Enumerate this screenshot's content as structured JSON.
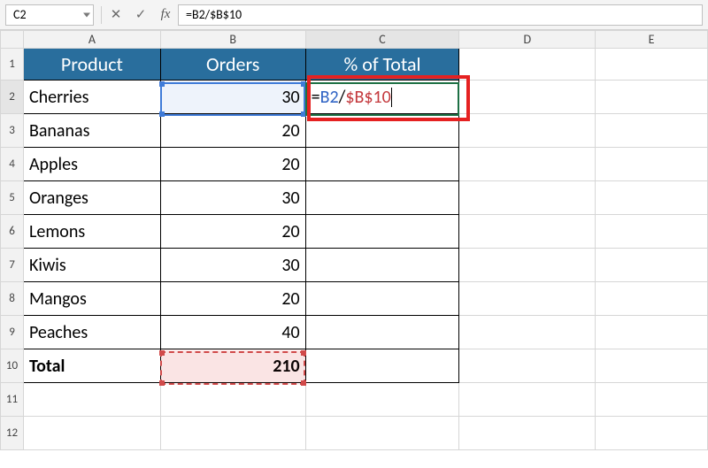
{
  "namebox": {
    "value": "C2"
  },
  "formula_bar": {
    "cancel": "✕",
    "accept": "✓",
    "fx": "fx",
    "formula": "=B2/$B$10"
  },
  "columns": [
    "A",
    "B",
    "C",
    "D",
    "E"
  ],
  "row_numbers": [
    "1",
    "2",
    "3",
    "4",
    "5",
    "6",
    "7",
    "8",
    "9",
    "10",
    "11",
    "12"
  ],
  "headers": {
    "A": "Product",
    "B": "Orders",
    "C": "% of Total"
  },
  "rows": [
    {
      "product": "Cherries",
      "orders": "30"
    },
    {
      "product": "Bananas",
      "orders": "20"
    },
    {
      "product": "Apples",
      "orders": "20"
    },
    {
      "product": "Oranges",
      "orders": "30"
    },
    {
      "product": "Lemons",
      "orders": "20"
    },
    {
      "product": "Kiwis",
      "orders": "30"
    },
    {
      "product": "Mangos",
      "orders": "20"
    },
    {
      "product": "Peaches",
      "orders": "40"
    }
  ],
  "total": {
    "label": "Total",
    "value": "210"
  },
  "cell_formula": {
    "eq": "=",
    "ref1": "B2",
    "op": "/",
    "ref2": "$B$10"
  },
  "colors": {
    "ref1": "#2f63c4",
    "ref2": "#c4393d",
    "active": "#1d7044",
    "header_bg": "#296e9d",
    "callout": "#e52121"
  }
}
